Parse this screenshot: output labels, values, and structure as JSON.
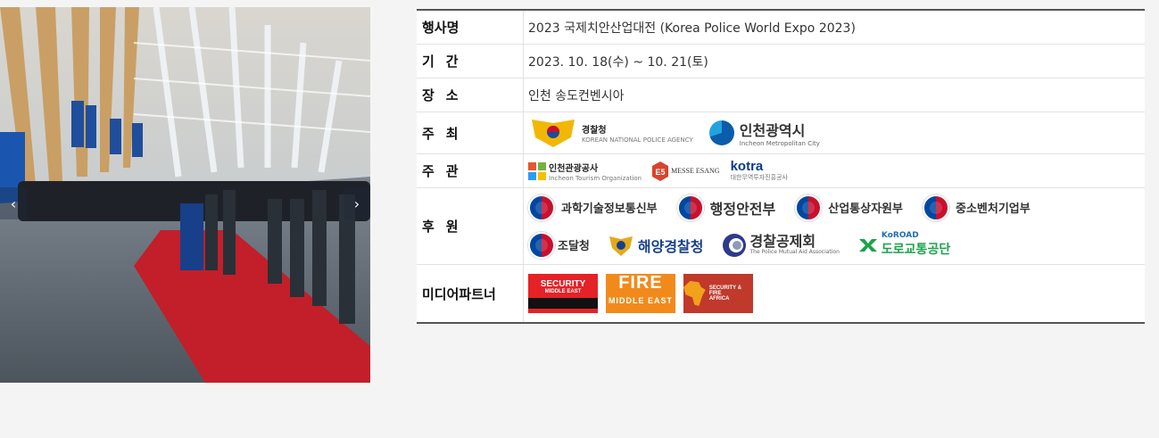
{
  "slider": {
    "prev_label": "‹",
    "next_label": "›"
  },
  "info": {
    "rows": [
      {
        "label": "행사명",
        "value": "2023 국제치안산업대전 (Korea Police World Expo 2023)"
      },
      {
        "label": "기간",
        "value": "2023. 10. 18(수) ~ 10. 21(토)"
      },
      {
        "label": "장소",
        "value": "인천 송도컨벤시아"
      },
      {
        "label": "주최"
      },
      {
        "label": "주관"
      },
      {
        "label": "후원"
      },
      {
        "label": "미디어파트너"
      }
    ]
  },
  "hosts": {
    "police_name": "경찰청",
    "police_sub": "KOREAN NATIONAL POLICE AGENCY",
    "incheon_name": "인천광역시",
    "incheon_sub": "Incheon Metropolitan City"
  },
  "organizers": {
    "ito_name": "인천관광공사",
    "ito_sub": "Incheon Tourism Organization",
    "messe_name": "MESSE ESANG",
    "kotra_name": "kotra",
    "kotra_sub": "대한무역투자진흥공사"
  },
  "sponsors": {
    "row1": [
      "과학기술정보통신부",
      "행정안전부",
      "산업통상자원부",
      "중소벤처기업부"
    ],
    "pps": "조달청",
    "coast_guard": "해양경찰청",
    "pma_name": "경찰공제회",
    "pma_sub": "The Police Mutual Aid Association",
    "koroad_top": "KoROAD",
    "koroad_name": "도로교통공단"
  },
  "media": {
    "security_title": "SECURITY",
    "security_sub": "MIDDLE EAST",
    "fire_title": "FIRE",
    "fire_sub": "MIDDLE EAST",
    "sfa_title": "SECURITY & FIRE",
    "sfa_sub": "AFRICA"
  },
  "colors": {
    "accent_red": "#c8102e",
    "accent_blue": "#0047a0",
    "border": "#555555"
  }
}
